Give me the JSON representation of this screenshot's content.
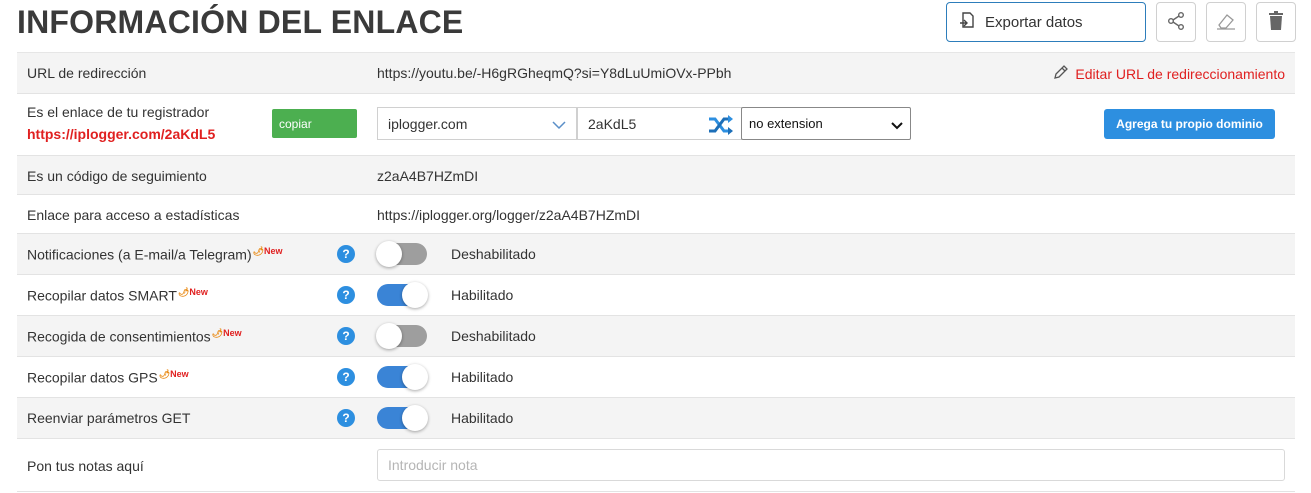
{
  "header": {
    "title": "INFORMACIÓN DEL ENLACE",
    "export_label": "Exportar datos"
  },
  "rows": {
    "redirect": {
      "label": "URL de redirección",
      "value": "https://youtu.be/-H6gRGheqmQ?si=Y8dLuUmiOVx-PPbh",
      "edit_label": "Editar URL de redireccionamiento"
    },
    "registrar": {
      "label": "Es el enlace de tu registrador",
      "link": "https://iplogger.com/2aKdL5",
      "copy_label": "copiar",
      "domain_value": "iplogger.com",
      "code_value": "2aKdL5",
      "extension_value": "no extension",
      "own_domain_label": "Agrega tu propio dominio"
    },
    "tracking": {
      "label": "Es un código de seguimiento",
      "value": "z2aA4B7HZmDI"
    },
    "stats": {
      "label": "Enlace para acceso a estadísticas",
      "value": "https://iplogger.org/logger/z2aA4B7HZmDI"
    },
    "notifications": {
      "label": "Notificaciones (a E-mail/a Telegram)",
      "badge": "New",
      "status": "Deshabilitado",
      "enabled": false
    },
    "smart": {
      "label": "Recopilar datos SMART",
      "badge": "New",
      "status": "Habilitado",
      "enabled": true
    },
    "consent": {
      "label": "Recogida de consentimientos",
      "badge": "New",
      "status": "Deshabilitado",
      "enabled": false
    },
    "gps": {
      "label": "Recopilar datos GPS",
      "badge": "New",
      "status": "Habilitado",
      "enabled": true
    },
    "get_params": {
      "label": "Reenviar parámetros GET",
      "status": "Habilitado",
      "enabled": true
    },
    "notes": {
      "label": "Pon tus notas aquí",
      "placeholder": "Introducir nota"
    }
  },
  "help_glyph": "?",
  "icons": [
    "export-icon",
    "share-icon",
    "eraser-icon",
    "trash-icon",
    "pencil-icon",
    "shuffle-icon",
    "chevron-down-icon",
    "help-icon",
    "flame-icon"
  ],
  "colors": {
    "accent_blue": "#2d8fe0",
    "link_red": "#e02020",
    "copy_green": "#4caf50",
    "toggle_on": "#3a84d6",
    "toggle_off": "#9e9e9e"
  }
}
